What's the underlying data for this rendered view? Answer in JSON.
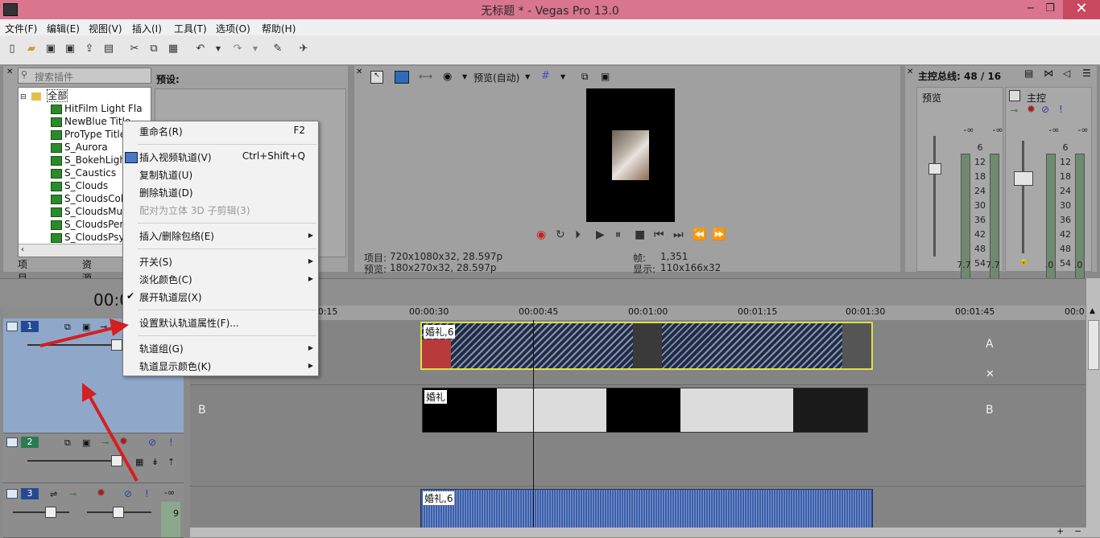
{
  "window": {
    "title": "无标题 * - Vegas Pro 13.0"
  },
  "menu": [
    "文件(F)",
    "编辑(E)",
    "视图(V)",
    "插入(I)",
    "工具(T)",
    "选项(O)",
    "帮助(H)"
  ],
  "plugins": {
    "search_placeholder": "搜索插件",
    "preset_label": "预设:",
    "tree_root": "全部",
    "items": [
      "HitFilm Light Fla",
      "NewBlue Title",
      "ProType Title",
      "S_Aurora",
      "S_BokehLigh",
      "S_Caustics",
      "S_Clouds",
      "S_CloudsCol",
      "S_CloudsMul",
      "S_CloudsPer",
      "S_CloudsPsy"
    ],
    "tabs": [
      "项目媒体",
      "资源管理"
    ]
  },
  "preview": {
    "quality": "预览(自动)",
    "project_label": "项目:",
    "project_value": "720x1080x32, 28.597p",
    "preview_label": "预览:",
    "preview_value": "180x270x32, 28.597p",
    "frame_label": "帧:",
    "frame_value": "1,351",
    "display_label": "显示:",
    "display_value": "110x166x32"
  },
  "master": {
    "title": "主控总线: 48 / 16",
    "preview_label": "预览",
    "master_label": "主控",
    "db_ticks": [
      "-∞",
      "6",
      "12",
      "18",
      "24",
      "30",
      "36",
      "42",
      "48",
      "54"
    ],
    "left_levels": [
      "7.7",
      "7.7"
    ],
    "right_levels": [
      ".0",
      ".0"
    ]
  },
  "timeline": {
    "timecode": "00:0",
    "ruler": [
      "00:00:15",
      "00:00:30",
      "00:00:45",
      "00:01:00",
      "00:01:15",
      "00:01:30",
      "00:01:45",
      "00:0"
    ],
    "tracks": [
      {
        "num": "1",
        "lane_letter": "A",
        "clip": "婚礼,6"
      },
      {
        "num": "2",
        "lane_letter": "B",
        "clip": "婚礼"
      },
      {
        "num": "3",
        "lane_letter": "",
        "clip": "婚礼,6"
      }
    ],
    "audio_vol": "-∞",
    "audio_meter": "9"
  },
  "context_menu": {
    "items": [
      {
        "label": "重命名(R)",
        "shortcut": "F2"
      },
      {
        "label": "插入视频轨道(V)",
        "shortcut": "Ctrl+Shift+Q"
      },
      {
        "label": "复制轨道(U)",
        "shortcut": ""
      },
      {
        "label": "删除轨道(D)",
        "shortcut": ""
      },
      {
        "label": "配对为立体 3D 子剪辑(3)",
        "shortcut": "",
        "disabled": true
      },
      {
        "label": "插入/删除包络(E)",
        "shortcut": "",
        "submenu": true
      },
      {
        "label": "开关(S)",
        "shortcut": "",
        "submenu": true
      },
      {
        "label": "淡化颜色(C)",
        "shortcut": "",
        "submenu": true
      },
      {
        "label": "展开轨道层(X)",
        "shortcut": "",
        "checked": true
      },
      {
        "label": "设置默认轨道属性(F)...",
        "shortcut": ""
      },
      {
        "label": "轨道组(G)",
        "shortcut": "",
        "submenu": true
      },
      {
        "label": "轨道显示颜色(K)",
        "shortcut": "",
        "submenu": true
      }
    ]
  },
  "colors": {
    "titlebar": "#d9758f",
    "track1_bg": "#8fa8c9",
    "arrow": "#d42020",
    "audio": "#3b5ea8"
  }
}
